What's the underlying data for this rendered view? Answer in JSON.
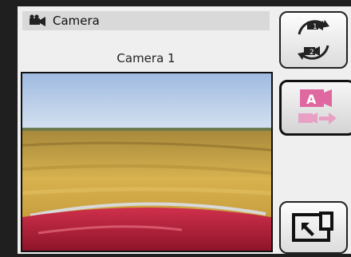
{
  "header": {
    "title": "Camera",
    "icon": "video-camera-icon"
  },
  "viewer": {
    "camera_name": "Camera 1"
  },
  "buttons": {
    "switch_camera": {
      "icon": "camera-switch-icon",
      "labels": [
        "1",
        "2"
      ]
    },
    "camera_mode": {
      "icon": "camera-mode-icon",
      "label": "A"
    },
    "fullscreen": {
      "icon": "fullscreen-icon"
    }
  },
  "colors": {
    "title_bar": "#d9d9d9",
    "accent_pink": "#e0609a",
    "field_gold": "#c9a24a",
    "hood_red": "#b8203a"
  }
}
